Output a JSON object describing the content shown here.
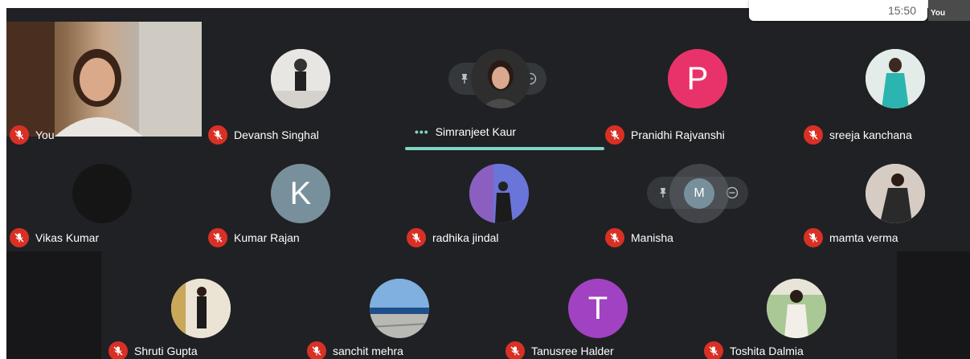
{
  "top_bar": {
    "clock": "15:50"
  },
  "self_thumbnail": {
    "label": "You"
  },
  "participants": [
    {
      "name": "You",
      "muted": true,
      "avatar": "video"
    },
    {
      "name": "Devansh Singhal",
      "muted": true,
      "avatar": "photo"
    },
    {
      "name": "Simranjeet Kaur",
      "muted": false,
      "speaking": true,
      "avatar": "photo"
    },
    {
      "name": "Pranidhi Rajvanshi",
      "muted": true,
      "avatar": "letter",
      "letter": "P",
      "color": "#e8336a"
    },
    {
      "name": "sreeja kanchana",
      "muted": true,
      "avatar": "photo"
    },
    {
      "name": "Vikas Kumar",
      "muted": true,
      "avatar": "dark"
    },
    {
      "name": "Kumar Rajan",
      "muted": true,
      "avatar": "letter",
      "letter": "K",
      "color": "#78909c"
    },
    {
      "name": "radhika jindal",
      "muted": true,
      "avatar": "photo"
    },
    {
      "name": "Manisha",
      "muted": true,
      "avatar": "letter",
      "letter": "M",
      "color": "#78909c"
    },
    {
      "name": "mamta verma",
      "muted": true,
      "avatar": "photo"
    },
    {
      "name": "Shruti Gupta",
      "muted": true,
      "avatar": "photo"
    },
    {
      "name": "sanchit mehra",
      "muted": true,
      "avatar": "photo"
    },
    {
      "name": "Tanusree Halder",
      "muted": true,
      "avatar": "letter",
      "letter": "T",
      "color": "#a142c2"
    },
    {
      "name": "Toshita Dalmia",
      "muted": true,
      "avatar": "photo"
    }
  ],
  "colors": {
    "background": "#202124",
    "muted_badge": "#d93025",
    "speaking_accent": "#7fd6c6"
  },
  "icons": {
    "muted": "mic-off-icon",
    "pin": "pin-icon",
    "remove": "minus-circle-icon"
  }
}
